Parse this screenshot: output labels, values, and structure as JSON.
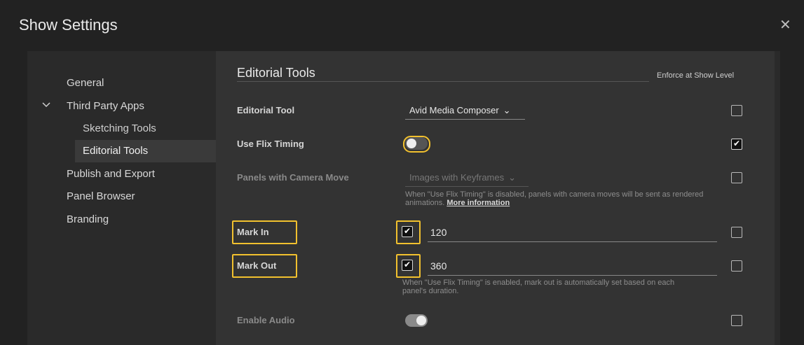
{
  "dialog": {
    "title": "Show Settings",
    "close_glyph": "✕"
  },
  "sidebar": {
    "items": [
      {
        "label": "General"
      },
      {
        "label": "Third Party Apps"
      },
      {
        "label": "Sketching Tools"
      },
      {
        "label": "Editorial Tools"
      },
      {
        "label": "Publish and Export"
      },
      {
        "label": "Panel Browser"
      },
      {
        "label": "Branding"
      }
    ]
  },
  "content": {
    "section_title": "Editorial Tools",
    "enforce_header": "Enforce at Show Level",
    "rows": {
      "editorial_tool": {
        "label": "Editorial Tool",
        "value": "Avid Media Composer",
        "enforced": false
      },
      "use_flix_timing": {
        "label": "Use Flix Timing",
        "on": false,
        "enforced": true
      },
      "panels_camera_move": {
        "label": "Panels with Camera Move",
        "value": "Images with Keyframes",
        "help": "When \"Use Flix Timing\" is disabled, panels with camera moves will be sent as rendered",
        "help_line2": "animations.",
        "help_link": "More information",
        "enforced": false
      },
      "mark_in": {
        "label": "Mark In",
        "checked": true,
        "value": "120",
        "enforced": false
      },
      "mark_out": {
        "label": "Mark Out",
        "checked": true,
        "value": "360",
        "help": "When \"Use Flix Timing\" is enabled, mark out is automatically set based on each",
        "help_line2": "panel's duration.",
        "enforced": false
      },
      "enable_audio": {
        "label": "Enable Audio",
        "on": true,
        "enforced": false
      }
    }
  },
  "colors": {
    "highlight": "#f2c12e",
    "background": "#222222",
    "content_bg": "#333333"
  },
  "icons": {
    "close": "close-icon",
    "chevron": "chevron-down-icon",
    "check": "check-icon"
  }
}
